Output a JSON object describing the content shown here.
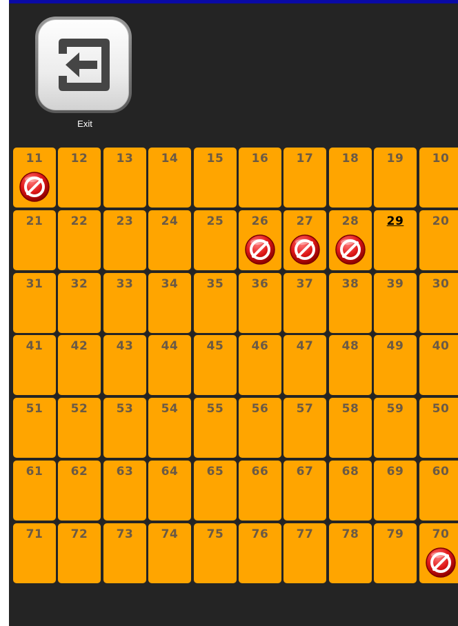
{
  "exit": {
    "label": "Exit",
    "icon": "exit-arrow-icon"
  },
  "colors": {
    "background": "#242424",
    "top_bar": "#0a0aa6",
    "seat": "#ffa500",
    "seat_number": "#6b5a45",
    "blocked": "#e01818"
  },
  "seats": [
    [
      {
        "number": "11",
        "blocked": true
      },
      {
        "number": "12",
        "blocked": false
      },
      {
        "number": "13",
        "blocked": false
      },
      {
        "number": "14",
        "blocked": false
      },
      {
        "number": "15",
        "blocked": false
      },
      {
        "number": "16",
        "blocked": false
      },
      {
        "number": "17",
        "blocked": false
      },
      {
        "number": "18",
        "blocked": false
      },
      {
        "number": "19",
        "blocked": false
      },
      {
        "number": "10",
        "blocked": false
      }
    ],
    [
      {
        "number": "21",
        "blocked": false
      },
      {
        "number": "22",
        "blocked": false
      },
      {
        "number": "23",
        "blocked": false
      },
      {
        "number": "24",
        "blocked": false
      },
      {
        "number": "25",
        "blocked": false
      },
      {
        "number": "26",
        "blocked": true
      },
      {
        "number": "27",
        "blocked": true
      },
      {
        "number": "28",
        "blocked": true
      },
      {
        "number": "29",
        "blocked": false,
        "current": true
      },
      {
        "number": "20",
        "blocked": false
      }
    ],
    [
      {
        "number": "31",
        "blocked": false
      },
      {
        "number": "32",
        "blocked": false
      },
      {
        "number": "33",
        "blocked": false
      },
      {
        "number": "34",
        "blocked": false
      },
      {
        "number": "35",
        "blocked": false
      },
      {
        "number": "36",
        "blocked": false
      },
      {
        "number": "37",
        "blocked": false
      },
      {
        "number": "38",
        "blocked": false
      },
      {
        "number": "39",
        "blocked": false
      },
      {
        "number": "30",
        "blocked": false
      }
    ],
    [
      {
        "number": "41",
        "blocked": false
      },
      {
        "number": "42",
        "blocked": false
      },
      {
        "number": "43",
        "blocked": false
      },
      {
        "number": "44",
        "blocked": false
      },
      {
        "number": "45",
        "blocked": false
      },
      {
        "number": "46",
        "blocked": false
      },
      {
        "number": "47",
        "blocked": false
      },
      {
        "number": "48",
        "blocked": false
      },
      {
        "number": "49",
        "blocked": false
      },
      {
        "number": "40",
        "blocked": false
      }
    ],
    [
      {
        "number": "51",
        "blocked": false
      },
      {
        "number": "52",
        "blocked": false
      },
      {
        "number": "53",
        "blocked": false
      },
      {
        "number": "54",
        "blocked": false
      },
      {
        "number": "55",
        "blocked": false
      },
      {
        "number": "56",
        "blocked": false
      },
      {
        "number": "57",
        "blocked": false
      },
      {
        "number": "58",
        "blocked": false
      },
      {
        "number": "59",
        "blocked": false
      },
      {
        "number": "50",
        "blocked": false
      }
    ],
    [
      {
        "number": "61",
        "blocked": false
      },
      {
        "number": "62",
        "blocked": false
      },
      {
        "number": "63",
        "blocked": false
      },
      {
        "number": "64",
        "blocked": false
      },
      {
        "number": "65",
        "blocked": false
      },
      {
        "number": "66",
        "blocked": false
      },
      {
        "number": "67",
        "blocked": false
      },
      {
        "number": "68",
        "blocked": false
      },
      {
        "number": "69",
        "blocked": false
      },
      {
        "number": "60",
        "blocked": false
      }
    ],
    [
      {
        "number": "71",
        "blocked": false
      },
      {
        "number": "72",
        "blocked": false
      },
      {
        "number": "73",
        "blocked": false
      },
      {
        "number": "74",
        "blocked": false
      },
      {
        "number": "75",
        "blocked": false
      },
      {
        "number": "76",
        "blocked": false
      },
      {
        "number": "77",
        "blocked": false
      },
      {
        "number": "78",
        "blocked": false
      },
      {
        "number": "79",
        "blocked": false
      },
      {
        "number": "70",
        "blocked": true
      }
    ]
  ]
}
